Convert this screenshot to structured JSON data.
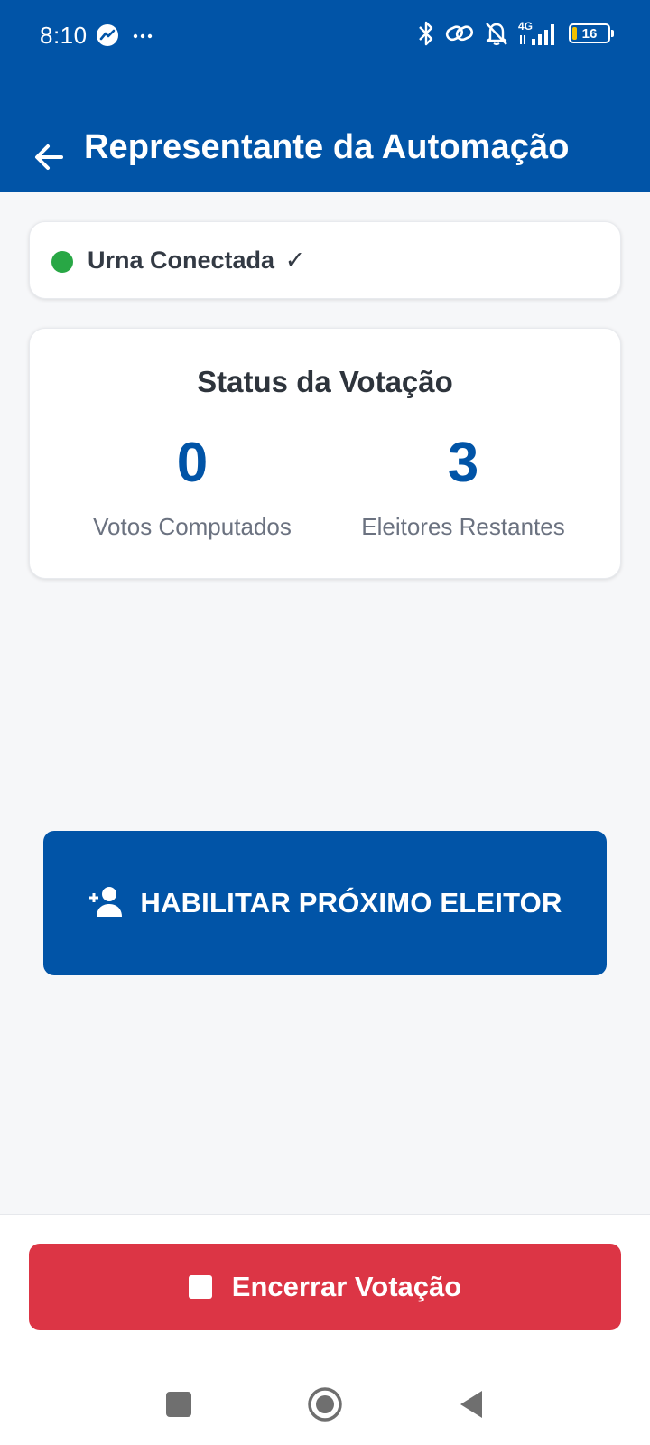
{
  "status_bar": {
    "time": "8:10",
    "left_icons": [
      "messenger-icon",
      "more-dots-icon"
    ],
    "right_icons": [
      "bluetooth-icon",
      "link-icon",
      "bell-off-icon",
      "signal-4g-icon",
      "battery-icon"
    ],
    "network": "4G",
    "battery_level": "16"
  },
  "header": {
    "title": "Representante da Automação",
    "background_color": "#0154a7"
  },
  "connection": {
    "label": "Urna Conectada",
    "check": "✓",
    "status_color": "#28a745"
  },
  "voting_status": {
    "title": "Status da Votação",
    "votes_value": "0",
    "votes_label": "Votos Computados",
    "remaining_value": "3",
    "remaining_label": "Eleitores Restantes"
  },
  "actions": {
    "enable_next_label": "HABILITAR PRÓXIMO ELEITOR",
    "end_voting_label": "Encerrar Votação",
    "end_color": "#dc3545"
  },
  "nav_bar": {
    "buttons": [
      "recent-apps-icon",
      "home-icon",
      "back-icon"
    ]
  }
}
